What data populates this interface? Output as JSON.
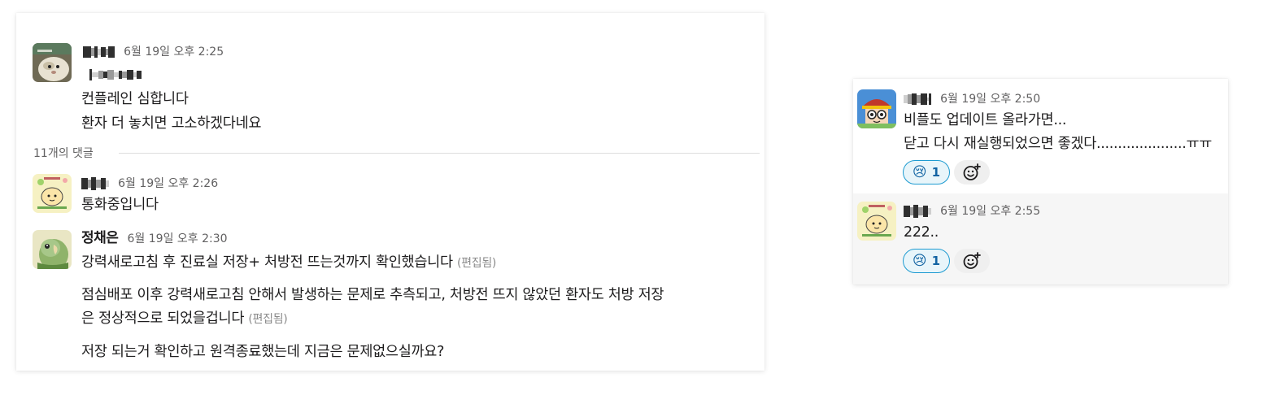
{
  "left_thread": {
    "root": {
      "time": "6월 19일 오후 2:25",
      "lines": [
        "컨플레인 심합니다",
        "환자 더 놓치면 고소하겠다네요"
      ]
    },
    "reply_count_label": "11개의 댓글",
    "replies": [
      {
        "time": "6월 19일 오후 2:26",
        "lines": [
          "통화중입니다"
        ]
      },
      {
        "author": "정채은",
        "time": "6월 19일 오후 2:30",
        "line1": "강력새로고침 후 진료실 저장+ 처방전 뜨는것까지 확인했습니다",
        "edited_label": "(편집됨)",
        "para2_line1": "점심배포 이후 강력새로고침 안해서 발생하는 문제로 추측되고, 처방전 뜨지 않았던 환자도 처방 저장",
        "para2_line2": "은 정상적으로 되었을겁니다",
        "para3": "저장 되는거 확인하고 원격종료했는데 지금은 문제없으실까요?"
      }
    ]
  },
  "right_thread": {
    "messages": [
      {
        "time": "6월 19일 오후 2:50",
        "lines": [
          "비플도 업데이트 올라가면...",
          "닫고 다시 재실행되었으면 좋겠다.....................ㅠㅠ"
        ],
        "reaction": {
          "emoji": "😢",
          "count": "1"
        }
      },
      {
        "time": "6월 19일 오후 2:55",
        "lines": [
          "222.."
        ],
        "reaction": {
          "emoji": "😢",
          "count": "1"
        }
      }
    ]
  },
  "colors": {
    "reaction_bg": "#e8f5fa",
    "reaction_border": "#1d9bd1",
    "reaction_text": "#1264a3",
    "timestamp": "#616061",
    "edited": "#8a8a8a"
  },
  "icons": {
    "add_reaction": "add-emoji-icon"
  }
}
